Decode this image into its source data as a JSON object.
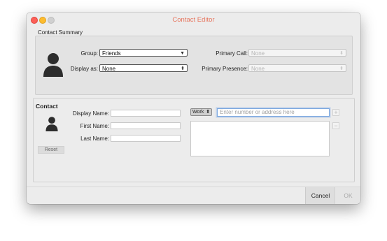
{
  "window": {
    "title": "Contact Editor"
  },
  "summary": {
    "group_title": "Contact Summary",
    "group_label": "Group:",
    "group_value": "Friends",
    "display_as_label": "Display as:",
    "display_as_value": "None",
    "primary_call_label": "Primary Call:",
    "primary_call_value": "None",
    "primary_presence_label": "Primary Presence:",
    "primary_presence_value": "None"
  },
  "contact": {
    "group_title": "Contact",
    "display_name_label": "Display Name:",
    "first_name_label": "First Name:",
    "last_name_label": "Last Name:",
    "display_name_value": "",
    "first_name_value": "",
    "last_name_value": "",
    "reset_label": "Reset",
    "address_type": "Work",
    "address_placeholder": "Enter number or address here",
    "add_symbol": "+",
    "remove_symbol": "−"
  },
  "footer": {
    "cancel_label": "Cancel",
    "ok_label": "OK"
  },
  "colors": {
    "title": "#e7765f",
    "close": "#fc5f57",
    "minimize": "#fdbc2e",
    "maximize": "#d0d0d0",
    "focus": "#7aa7e0"
  },
  "icons": {
    "avatar": "person-silhouette-icon",
    "updown": "updown-arrows-icon",
    "dropdown": "chevron-down-icon"
  }
}
